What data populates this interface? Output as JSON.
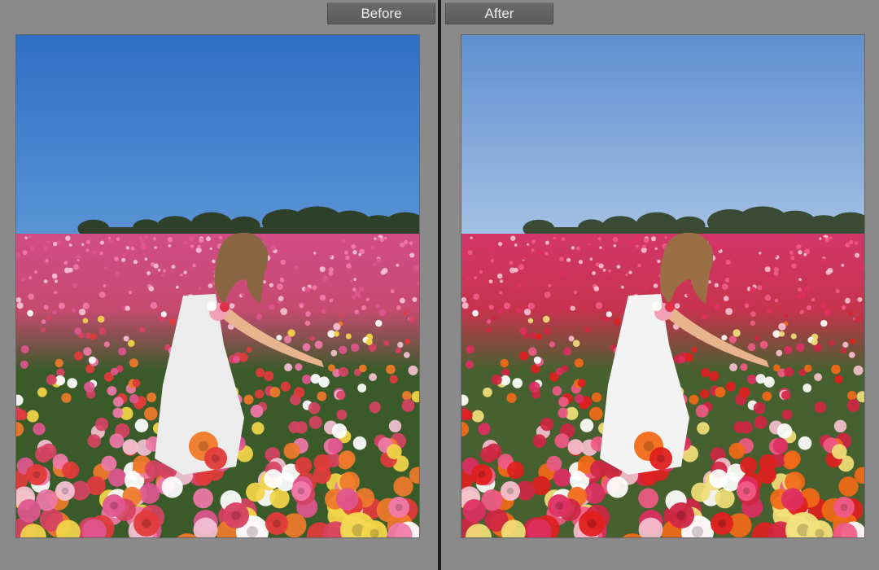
{
  "compare": {
    "before": {
      "label": "Before"
    },
    "after": {
      "label": "After"
    }
  },
  "colors": {
    "panel_bg": "#8a8a8a",
    "divider": "#1c1c1c",
    "tab_bg": "#606060",
    "tab_text": "#ececec",
    "before": {
      "sky_top": "#2f6fc4",
      "sky_bottom": "#5a94d6",
      "field_far": "#d14d86",
      "field_mid": "#c64a70",
      "foliage": "#3b5a2a",
      "trees": "#2e3f2a",
      "dress": "#ececec",
      "hair": "#8a6542"
    },
    "after": {
      "sky_top": "#5f8fd0",
      "sky_bottom": "#a3c1e4",
      "field_far": "#d1366a",
      "field_mid": "#c7334d",
      "foliage": "#47602f",
      "trees": "#3a4a34",
      "dress": "#f3f3f3",
      "hair": "#9b6e45"
    }
  }
}
